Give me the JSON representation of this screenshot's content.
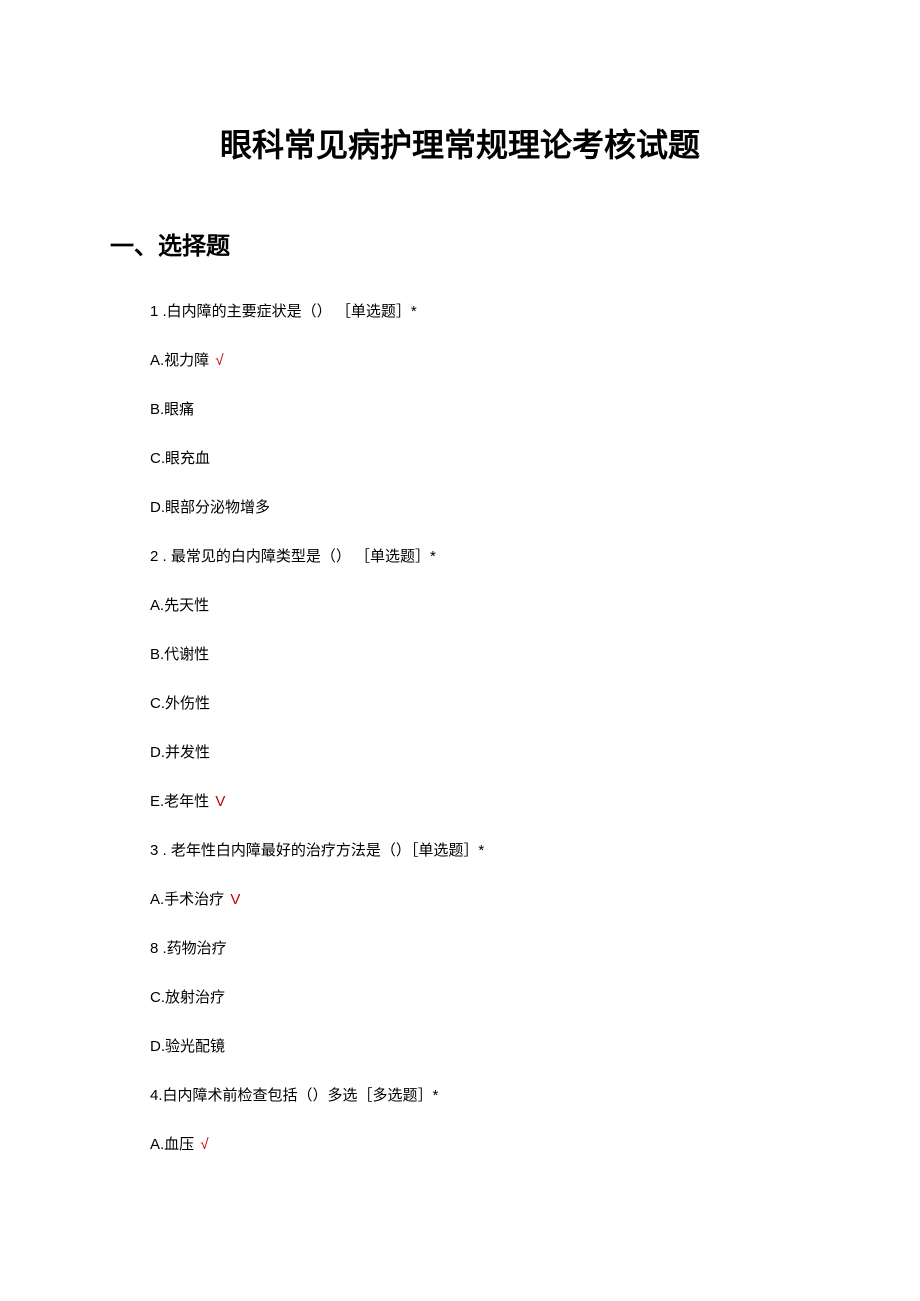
{
  "title": "眼科常见病护理常规理论考核试题",
  "section_heading": "一、选择题",
  "questions": [
    {
      "number": "1",
      "stem": " .白内障的主要症状是（） ［单选题］*",
      "options": [
        {
          "label": "A.视力障",
          "correct": true,
          "mark": " √"
        },
        {
          "label": "B.眼痛",
          "correct": false
        },
        {
          "label": "C.眼充血",
          "correct": false
        },
        {
          "label": "D.眼部分泌物增多",
          "correct": false
        }
      ]
    },
    {
      "number": "2",
      "stem": "  . 最常见的白内障类型是（） ［单选题］*",
      "options": [
        {
          "label": "A.先天性",
          "correct": false
        },
        {
          "label": "B.代谢性",
          "correct": false
        },
        {
          "label": "C.外伤性",
          "correct": false
        },
        {
          "label": "D.并发性",
          "correct": false
        },
        {
          "label": "E.老年性",
          "correct": true,
          "mark": " V"
        }
      ]
    },
    {
      "number": "3",
      "stem": "  . 老年性白内障最好的治疗方法是（）［单选题］*",
      "options": [
        {
          "label": "A.手术治疗",
          "correct": true,
          "mark": " V"
        },
        {
          "label": "8  .药物治疗",
          "correct": false
        },
        {
          "label": "C.放射治疗",
          "correct": false
        },
        {
          "label": "D.验光配镜",
          "correct": false
        }
      ]
    },
    {
      "number": "4",
      "stem": ".白内障术前检查包括（）多选［多选题］*",
      "options": [
        {
          "label": "A.血压",
          "correct": true,
          "mark": " √"
        }
      ]
    }
  ]
}
